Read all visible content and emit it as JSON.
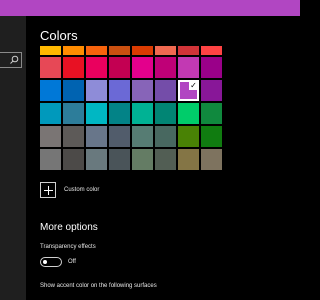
{
  "window": {
    "accent_color": "#b146c2"
  },
  "sidebar": {
    "search_icon": "search-icon"
  },
  "colors": {
    "title": "Colors",
    "rows": [
      [
        "#ffb900",
        "#ff8c00",
        "#f7630c",
        "#ca5010",
        "#da3b01",
        "#ef6950",
        "#d13438",
        "#ff4343"
      ],
      [
        "#e74856",
        "#e81123",
        "#ea005e",
        "#c30052",
        "#e3008c",
        "#bf0077",
        "#c239b3",
        "#9a0089"
      ],
      [
        "#0078d7",
        "#0063b1",
        "#8e8cd8",
        "#6b69d6",
        "#8764b8",
        "#744da9",
        "#b146c2",
        "#881798"
      ],
      [
        "#0099bc",
        "#2d7d9a",
        "#00b7c3",
        "#038387",
        "#00b294",
        "#018574",
        "#00cc6a",
        "#10893e"
      ],
      [
        "#7a7574",
        "#5d5a58",
        "#68768a",
        "#515c6b",
        "#567c73",
        "#486860",
        "#498205",
        "#107c10"
      ],
      [
        "#767676",
        "#4c4a48",
        "#69797e",
        "#4a5459",
        "#647c64",
        "#525e54",
        "#847545",
        "#7e735f"
      ]
    ],
    "selected": {
      "row": 2,
      "col": 6
    }
  },
  "custom_color": {
    "label": "Custom color"
  },
  "more_options": {
    "heading": "More options",
    "transparency_label": "Transparency effects",
    "transparency_state": "Off",
    "accent_label": "Show accent color on the following surfaces"
  }
}
